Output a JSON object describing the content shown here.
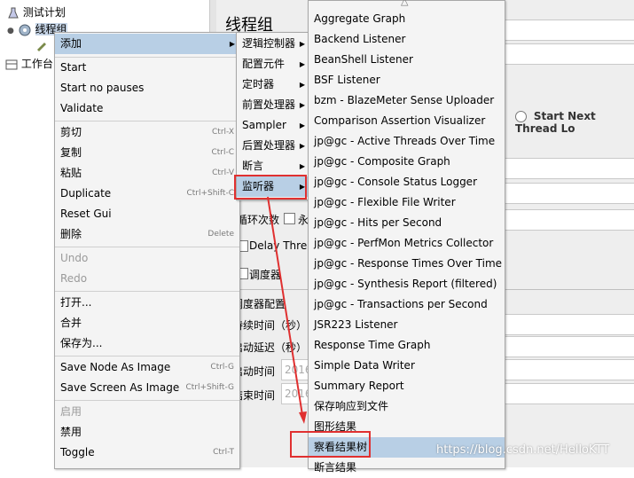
{
  "tree": {
    "items": [
      "测试计划",
      "线程组",
      "工作台"
    ]
  },
  "panel": {
    "title": "线程组",
    "radio_label": "Start Next Thread Lo",
    "labels": {
      "loop_count": "循环次数",
      "forever": "永",
      "delay_thread": "Delay Threa",
      "scheduler": "调度器",
      "scheduler_config": "调度器配置",
      "duration": "持续时间（秒）",
      "startup_delay": "启动延迟（秒）",
      "start_time": "启动时间",
      "end_time": "结束时间"
    },
    "time_value_1": "2016",
    "time_value_2": "2016"
  },
  "context_menu": {
    "add_label": "添加",
    "items": [
      {
        "label": "Start",
        "shortcut": ""
      },
      {
        "label": "Start no pauses",
        "shortcut": ""
      },
      {
        "label": "Validate",
        "shortcut": ""
      },
      {
        "label": "剪切",
        "shortcut": "Ctrl-X"
      },
      {
        "label": "复制",
        "shortcut": "Ctrl-C"
      },
      {
        "label": "粘贴",
        "shortcut": "Ctrl-V"
      },
      {
        "label": "Duplicate",
        "shortcut": "Ctrl+Shift-C"
      },
      {
        "label": "Reset Gui",
        "shortcut": ""
      },
      {
        "label": "删除",
        "shortcut": "Delete"
      },
      {
        "label": "Undo",
        "shortcut": ""
      },
      {
        "label": "Redo",
        "shortcut": ""
      },
      {
        "label": "打开...",
        "shortcut": ""
      },
      {
        "label": "合并",
        "shortcut": ""
      },
      {
        "label": "保存为...",
        "shortcut": ""
      },
      {
        "label": "Save Node As Image",
        "shortcut": "Ctrl-G"
      },
      {
        "label": "Save Screen As Image",
        "shortcut": "Ctrl+Shift-G"
      },
      {
        "label": "启用",
        "shortcut": ""
      },
      {
        "label": "禁用",
        "shortcut": ""
      },
      {
        "label": "Toggle",
        "shortcut": "Ctrl-T"
      }
    ]
  },
  "add_submenu": {
    "items": [
      "逻辑控制器",
      "配置元件",
      "定时器",
      "前置处理器",
      "Sampler",
      "后置处理器",
      "断言",
      "监听器"
    ]
  },
  "listener_submenu": {
    "items": [
      "Aggregate Graph",
      "Backend Listener",
      "BeanShell Listener",
      "BSF Listener",
      "bzm - BlazeMeter Sense Uploader",
      "Comparison Assertion Visualizer",
      "jp@gc - Active Threads Over Time",
      "jp@gc - Composite Graph",
      "jp@gc - Console Status Logger",
      "jp@gc - Flexible File Writer",
      "jp@gc - Hits per Second",
      "jp@gc - PerfMon Metrics Collector",
      "jp@gc - Response Times Over Time",
      "jp@gc - Synthesis Report (filtered)",
      "jp@gc - Transactions per Second",
      "JSR223 Listener",
      "Response Time Graph",
      "Simple Data Writer",
      "Summary Report",
      "保存响应到文件",
      "图形结果",
      "察看结果树",
      "断言结果"
    ]
  },
  "watermark": "https://blog.csdn.net/HelloKTT",
  "colors": {
    "highlight": "#b8cfe5",
    "annotation_red": "#e03030",
    "menu_bg": "#f4f4f4"
  }
}
